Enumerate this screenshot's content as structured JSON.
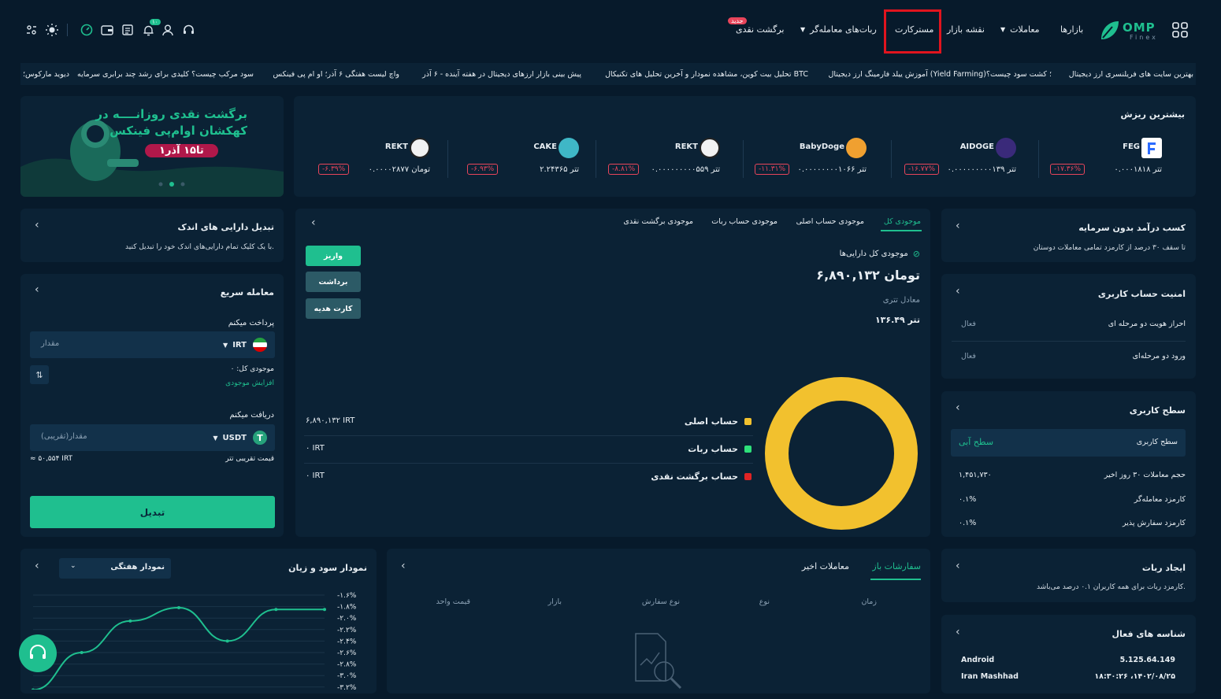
{
  "header": {
    "brand": "OMP",
    "brand_sub": "Finex",
    "nav": {
      "markets": "بازارها",
      "trades": "معاملات",
      "market_map": "نقشه بازار",
      "mastercard": "مسترکارت",
      "trading_bots": "ربات‌های معامله‌گر",
      "cashback": "برگشت نقدی",
      "new_badge": "جدید"
    },
    "notification_count": "۱۰"
  },
  "ticker": [
    "بهترین سایت های فریلنسری ارز دیجیتال",
    "آموزش ییلد فارمینگ ارز دیجیتال (Yield Farming)؛ کشت سود چیست؟",
    "تحلیل بیت کوین، مشاهده نمودار و آخرین تحلیل های تکنیکال BTC",
    "پیش بینی بازار ارزهای دیجیتال در هفته آینده - ۶ آذر",
    "واچ لیست هفتگی ۶ آذر؛ او ام پی فینکس",
    "سود مرکب چیست؟ کلیدی برای رشد چند برابری سرمایه",
    "دیوید مارکوس؛"
  ],
  "top_losers": {
    "title": "بیشترین ریزش",
    "coins": [
      {
        "symbol": "FEG",
        "price": "۰.۰۰۰۱۸۱۸ تتر",
        "change": "-۱۷.۳۶%",
        "color": "#2b6bff"
      },
      {
        "symbol": "AIDOGE",
        "price": "۰.۰۰۰۰۰۰۰۰۰۱۳۹ تتر",
        "change": "-۱۶.۷۷%",
        "color": "#6a4bd6"
      },
      {
        "symbol": "BabyDoge",
        "price": "۰.۰۰۰۰۰۰۰۰۱۰۶۶ تتر",
        "change": "-۱۱.۳۱%",
        "color": "#f0a030"
      },
      {
        "symbol": "REKT",
        "price": "۰.۰۰۰۰۰۰۰۰۰۵۵۹ تتر",
        "change": "-۸.۸۱%",
        "color": "#f2f2f2"
      },
      {
        "symbol": "CAKE",
        "price": "۲.۲۴۳۶۵ تتر",
        "change": "-۶.۹۳%",
        "color": "#3fb7c6"
      },
      {
        "symbol": "REKT",
        "price": "۰.۰۰۰۰۲۸۷۷ تومان",
        "change": "-۶.۳۹%",
        "color": "#f2f2f2"
      }
    ]
  },
  "banner": {
    "line1": "برگشت نقدی روزانــــه در",
    "line2": "کهکشان اوام‌پی فینکس",
    "dates": "۱تا۱۵ آذر"
  },
  "passive_income": {
    "title": "کسب درآمد بدون سرمایه",
    "desc": "تا سقف ۳۰ درصد از کارمزد تمامی معاملات دوستان"
  },
  "security": {
    "title": "امنیت حساب کاربری",
    "rows": [
      {
        "label": "احراز هویت دو مرحله ای",
        "status": "فعال"
      },
      {
        "label": "ورود دو مرحله‌ای",
        "status": "فعال"
      }
    ]
  },
  "user_level": {
    "title": "سطح کاربری",
    "level_label": "سطح کاربری",
    "level_value": "سطح آبی",
    "rows": [
      {
        "label": "حجم معاملات ۳۰ روز اخیر",
        "value": "۱,۴۵۱,۷۳۰"
      },
      {
        "label": "کارمزد معامله‌گر",
        "value": "۰.۱%"
      },
      {
        "label": "کارمزد سفارش پذیر",
        "value": "۰.۱%"
      }
    ]
  },
  "create_bot": {
    "title": "ایجاد ربات",
    "desc": "کارمزد ربات برای همه کاربران ۰.۱ درصد می‌باشد."
  },
  "active_sessions": {
    "title": "شناسه های فعال",
    "device": "Android",
    "ip": "5.125.64.149",
    "location": "Iran Mashhad",
    "time": "۱۸:۳۰:۲۶ ،۱۴۰۲/۰۸/۲۵"
  },
  "balance": {
    "tabs": [
      "موجودی کل",
      "موجودی حساب اصلی",
      "موجودی حساب ربات",
      "موجودی برگشت نقدی"
    ],
    "total_label": "موجودی کل دارایی‌ها",
    "total_value": "۶,۸۹۰,۱۳۲ تومان",
    "tether_label": "معادل تتری",
    "tether_value": "۱۳۶.۴۹ تتر",
    "buttons": {
      "deposit": "واریز",
      "withdraw": "برداشت",
      "gift": "کارت هدیه"
    },
    "accounts": [
      {
        "name": "حساب اصلی",
        "value": "۶,۸۹۰,۱۳۲ IRT",
        "color": "#f2c12e"
      },
      {
        "name": "حساب ربات",
        "value": "۰ IRT",
        "color": "#2ee07a"
      },
      {
        "name": "حساب برگشت نقدی",
        "value": "۰ IRT",
        "color": "#e02424"
      }
    ],
    "donut": [
      {
        "name": "حساب اصلی",
        "share": 1.0,
        "color": "#f2c12e"
      }
    ]
  },
  "small_assets": {
    "title": "تبدیل دارایی های اندک",
    "desc": "با یک کلیک تمام دارایی‌های اندک خود را تبدیل کنید."
  },
  "quick_trade": {
    "title": "معامله سریع",
    "pay_label": "پرداخت میکنم",
    "pay_currency": "IRT",
    "pay_placeholder": "مقدار",
    "balance_label": "موجودی کل: ۰",
    "increase": "افزایش موجودی",
    "receive_label": "دریافت میکنم",
    "receive_currency": "USDT",
    "receive_placeholder": "مقدار(تقریبی)",
    "approx_label": "قیمت تقریبی تتر",
    "approx_value": "≈ ۵۰,۵۵۴ IRT",
    "convert": "تبدیل"
  },
  "orders": {
    "tabs": [
      "سفارشات باز",
      "معاملات اخیر"
    ],
    "columns": [
      "زمان",
      "نوع",
      "نوع سفارش",
      "بازار",
      "قیمت واحد"
    ]
  },
  "pnl": {
    "title": "نمودار سود و زیان",
    "period": "نمودار هفتگی"
  },
  "chart_data": {
    "type": "line",
    "title": "نمودار سود و زیان",
    "ytick_labels": [
      "-۱.۶%",
      "-۱.۸%",
      "-۲.۰%",
      "-۲.۲%",
      "-۲.۴%",
      "-۲.۶%",
      "-۲.۸%",
      "-۳.۰%",
      "-۳.۲%"
    ],
    "ylim": [
      -3.2,
      -1.6
    ],
    "x": [
      1,
      2,
      3,
      4,
      5,
      6,
      7
    ],
    "values": [
      -3.25,
      -2.6,
      -2.05,
      -1.82,
      -2.4,
      -1.85,
      -1.85
    ],
    "color": "#1fbf8f"
  }
}
